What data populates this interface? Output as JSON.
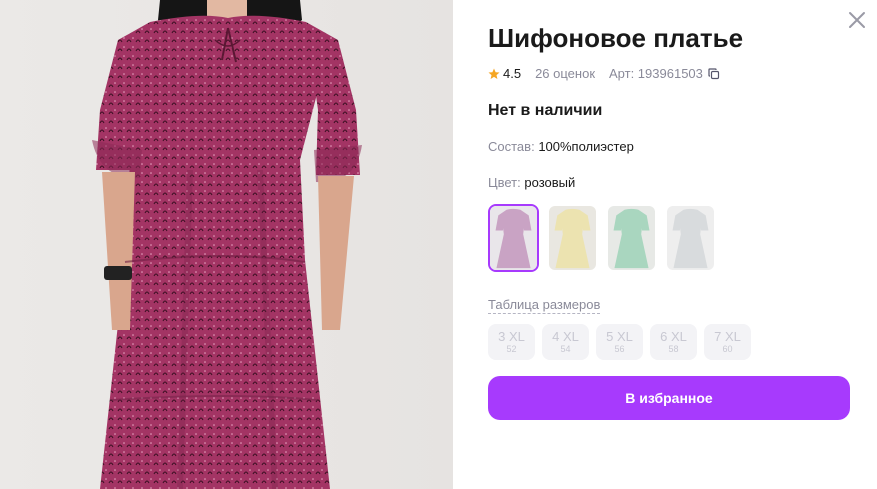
{
  "product": {
    "title": "Шифоновое платье",
    "rating": "4.5",
    "reviews": "26 оценок",
    "article": "Арт: 193961503",
    "stock_status": "Нет в наличии",
    "composition_label": "Состав:",
    "composition_value": "100%полиэстер",
    "color_label": "Цвет:",
    "color_value": "розовый"
  },
  "swatches": [
    {
      "name": "pink",
      "bg": "#e9e6ea",
      "dress": "#c9a3c4",
      "selected": true
    },
    {
      "name": "yellow",
      "bg": "#e9e7e1",
      "dress": "#ece3b0",
      "selected": false
    },
    {
      "name": "mint",
      "bg": "#e7e9e6",
      "dress": "#a9d6bf",
      "selected": false
    },
    {
      "name": "grey",
      "bg": "#eeeeee",
      "dress": "#d8dbdd",
      "selected": false
    }
  ],
  "size_table_link": "Таблица размеров",
  "sizes": [
    {
      "label": "3 XL",
      "ru": "52"
    },
    {
      "label": "4 XL",
      "ru": "54"
    },
    {
      "label": "5 XL",
      "ru": "56"
    },
    {
      "label": "6 XL",
      "ru": "58"
    },
    {
      "label": "7 XL",
      "ru": "60"
    }
  ],
  "favorite_button": "В избранное",
  "colors": {
    "accent": "#a73afd",
    "star": "#f5a623",
    "dress": "#9b2f5e",
    "muted_text": "#8a8a99"
  },
  "icons": {
    "close": "close-icon",
    "star": "star-icon",
    "copy": "copy-icon"
  }
}
